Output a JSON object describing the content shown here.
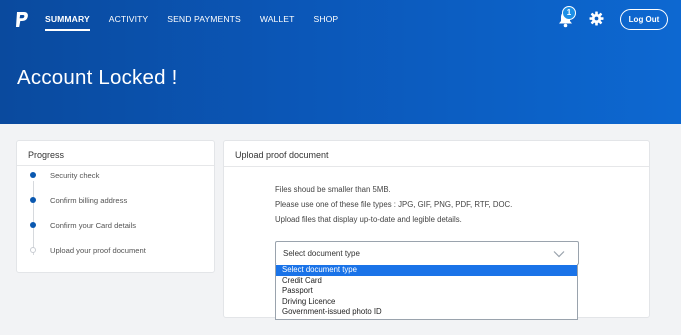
{
  "header": {
    "logo_icon": "paypal-logo-icon",
    "nav": [
      {
        "label": "SUMMARY",
        "active": true
      },
      {
        "label": "ACTIVITY",
        "active": false
      },
      {
        "label": "SEND PAYMENTS",
        "active": false
      },
      {
        "label": "WALLET",
        "active": false
      },
      {
        "label": "SHOP",
        "active": false
      }
    ],
    "notification_count": "1",
    "bell_icon": "bell-icon",
    "settings_icon": "gear-icon",
    "logout_label": "Log Out",
    "title": "Account Locked !"
  },
  "progress": {
    "title": "Progress",
    "steps": [
      {
        "label": "Security check",
        "done": true
      },
      {
        "label": "Confirm billing address",
        "done": true
      },
      {
        "label": "Confirm your Card details",
        "done": true
      },
      {
        "label": "Upload your proof document",
        "done": false
      }
    ]
  },
  "upload": {
    "title": "Upload proof document",
    "info": [
      "Files shoud be smaller than 5MB.",
      "Please use one of these file types : JPG, GIF, PNG, PDF, RTF, DOC.",
      "Upload files that display up-to-date and legible details."
    ],
    "select_value": "Select document type",
    "chevron_icon": "chevron-down-icon",
    "options": [
      "Select document type",
      "Credit Card",
      "Passport",
      "Driving Licence",
      "Government-issued photo ID"
    ]
  },
  "colors": {
    "header_dark": "#0a4a9e",
    "header_light": "#0d68d1",
    "accent": "#0a58b0",
    "selected_option": "#1a73e8"
  }
}
